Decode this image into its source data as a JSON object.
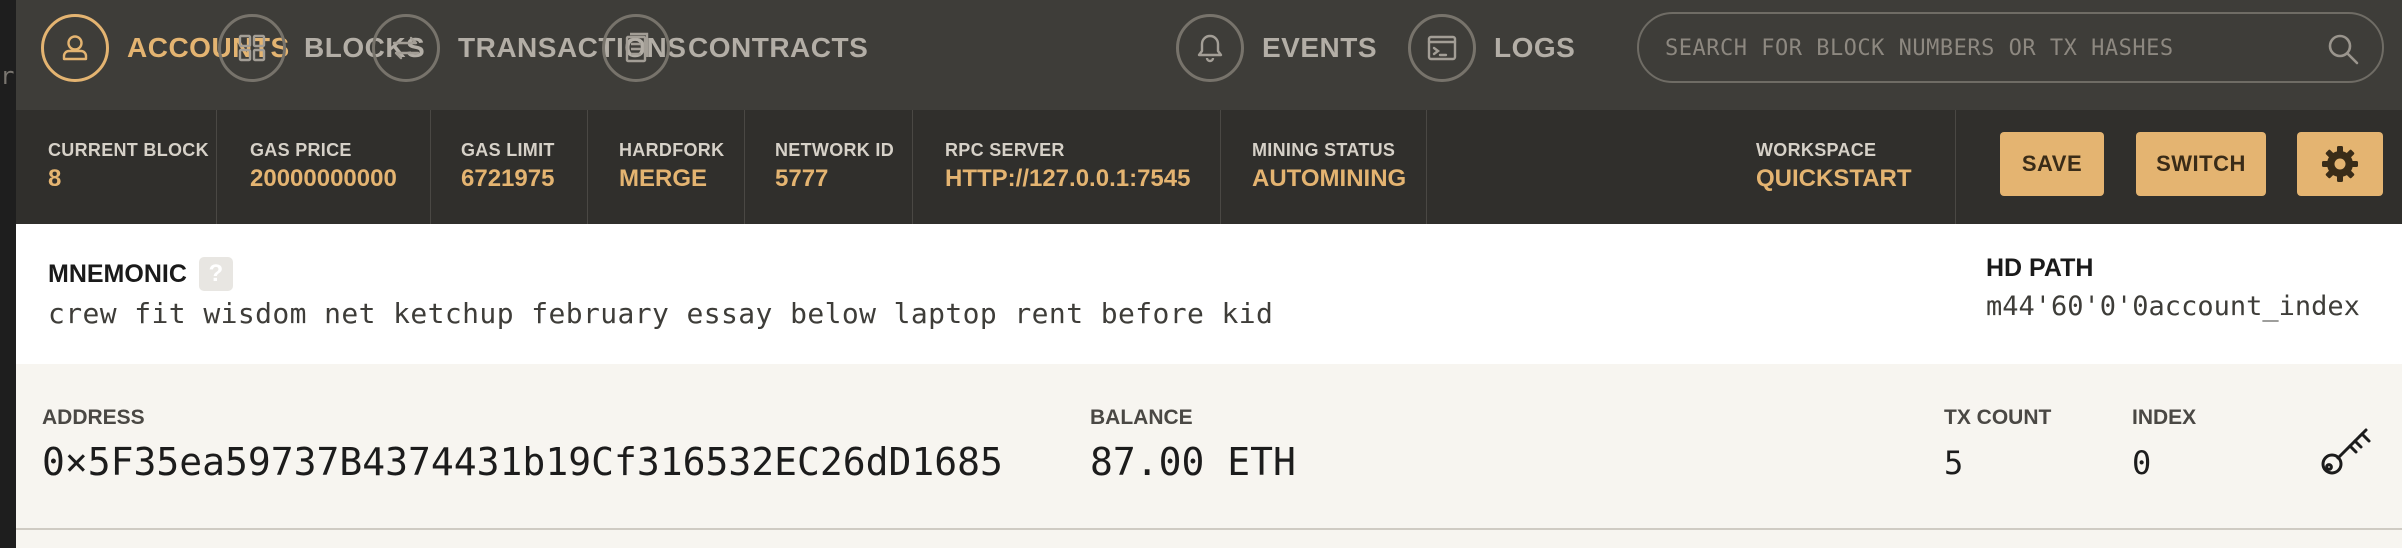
{
  "left_fragment": "rt",
  "nav": {
    "accounts": "ACCOUNTS",
    "blocks": "BLOCKS",
    "transactions": "TRANSACTIONS",
    "contracts": "CONTRACTS",
    "events": "EVENTS",
    "logs": "LOGS",
    "active": "accounts",
    "search_placeholder": "SEARCH FOR BLOCK NUMBERS OR TX HASHES",
    "search_value": ""
  },
  "status": {
    "current_block": {
      "label": "CURRENT BLOCK",
      "value": "8"
    },
    "gas_price": {
      "label": "GAS PRICE",
      "value": "20000000000"
    },
    "gas_limit": {
      "label": "GAS LIMIT",
      "value": "6721975"
    },
    "hardfork": {
      "label": "HARDFORK",
      "value": "MERGE"
    },
    "network_id": {
      "label": "NETWORK ID",
      "value": "5777"
    },
    "rpc_server": {
      "label": "RPC SERVER",
      "value": "HTTP://127.0.0.1:7545"
    },
    "mining_status": {
      "label": "MINING STATUS",
      "value": "AUTOMINING"
    },
    "workspace": {
      "label": "WORKSPACE",
      "value": "QUICKSTART"
    },
    "save_label": "SAVE",
    "switch_label": "SWITCH"
  },
  "mnemonic": {
    "title": "MNEMONIC",
    "help": "?",
    "words": "crew fit wisdom net ketchup february essay below laptop rent before kid",
    "hd_path_label": "HD PATH",
    "hd_path_value": "m44'60'0'0account_index"
  },
  "account": {
    "address_label": "ADDRESS",
    "address": "0×5F35ea59737B4374431b19Cf316532EC26dD1685",
    "balance_label": "BALANCE",
    "balance": "87.00 ETH",
    "tx_count_label": "TX COUNT",
    "tx_count": "5",
    "index_label": "INDEX",
    "index": "0"
  },
  "colors": {
    "accent": "#e4b471",
    "nav_bg": "#3e3d39",
    "status_bg": "#302f2c"
  }
}
